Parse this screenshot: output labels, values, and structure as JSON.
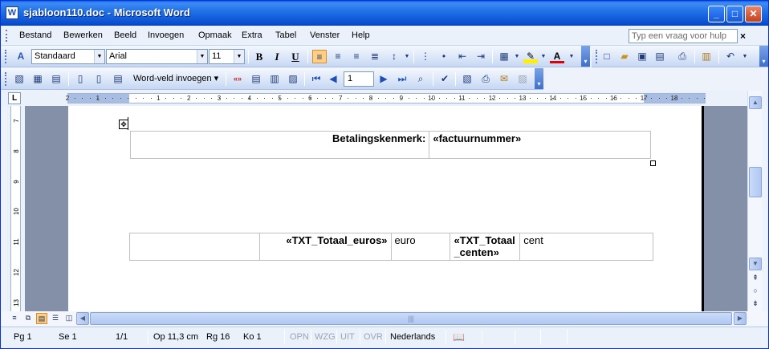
{
  "window": {
    "title": "sjabloon110.doc - Microsoft Word",
    "app_icon": "W",
    "controls": {
      "minimize": "_",
      "maximize": "□",
      "close": "✕"
    }
  },
  "menu": {
    "items": [
      "Bestand",
      "Bewerken",
      "Beeld",
      "Invoegen",
      "Opmaak",
      "Extra",
      "Tabel",
      "Venster",
      "Help"
    ],
    "help_placeholder": "Typ een vraag voor hulp",
    "help_close": "×"
  },
  "formatting": {
    "style": "Standaard",
    "font": "Arial",
    "size": "11",
    "bold": "B",
    "italic": "I",
    "underline": "U"
  },
  "mailmerge": {
    "insert_word_field": "Word-veld invoegen ▾",
    "record_number": "1"
  },
  "ruler": {
    "numbers": [
      "2",
      "1",
      "1",
      "2",
      "3",
      "4",
      "5",
      "6",
      "7",
      "8",
      "9",
      "10",
      "11",
      "12",
      "13",
      "14",
      "15",
      "16",
      "17",
      "18"
    ],
    "vertical_numbers": [
      "7",
      "8",
      "9",
      "10",
      "11",
      "12",
      "13"
    ],
    "corner": "L"
  },
  "document": {
    "table1": {
      "label": "Betalingskenmerk:",
      "field": "«factuurnummer»"
    },
    "table2": {
      "euros_field": "«TXT_Totaal_euros»",
      "euro_unit": "euro",
      "cents_field": "«TXT_Totaal_centen»",
      "cent_unit": "cent"
    }
  },
  "status": {
    "page": "Pg  1",
    "section": "Se  1",
    "page_of": "1/1",
    "at": "Op  11,3 cm",
    "line": "Rg  16",
    "col": "Ko  1",
    "rec": "OPN",
    "trk": "WZG",
    "ext": "UIT",
    "ovr": "OVR",
    "language": "Nederlands"
  }
}
